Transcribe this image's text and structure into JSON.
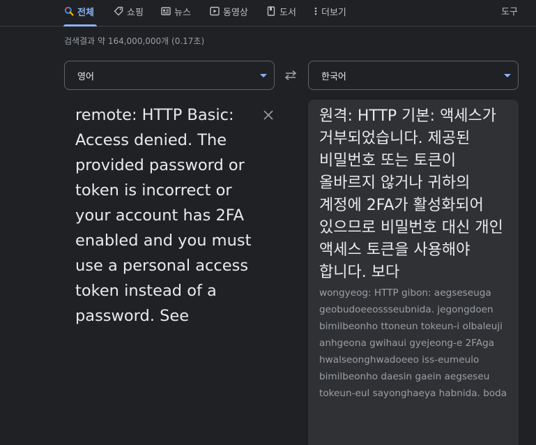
{
  "nav": {
    "tabs": [
      {
        "label": "전체",
        "icon": "search-icon"
      },
      {
        "label": "쇼핑",
        "icon": "tag-icon"
      },
      {
        "label": "뉴스",
        "icon": "newspaper-icon"
      },
      {
        "label": "동영상",
        "icon": "play-icon"
      },
      {
        "label": "도서",
        "icon": "book-icon"
      },
      {
        "label": "더보기",
        "icon": "more-vert-icon"
      }
    ],
    "tools": "도구",
    "active_color": "#8ab4f8"
  },
  "stats": "검색결과 약 164,000,000개 (0.17초)",
  "translator": {
    "source_lang": "영어",
    "target_lang": "한국어",
    "source_text": "remote: HTTP Basic: Access denied. The provided password or token is incorrect or your account has 2FA enabled and you must use a personal access token instead of a password. See",
    "translated_text": "원격: HTTP 기본: 액세스가 거부되었습니다. 제공된 비밀번호 또는 토큰이 올바르지 않거나 귀하의 계정에 2FA가 활성화되어 있으므로 비밀번호 대신 개인 액세스 토큰을 사용해야 합니다. 보다",
    "romanization": "wongyeog: HTTP gibon: aegseseuga geobudoeeossseubnida. jegongdoen bimilbeonho ttoneun tokeun-i olbaleuji anhgeona gwihaui gyejeong-e 2FAga hwalseonghwadoeeo iss-eumeulo bimilbeonho daesin gaein aegseseu tokeun-eul sayonghaeya habnida. boda"
  }
}
